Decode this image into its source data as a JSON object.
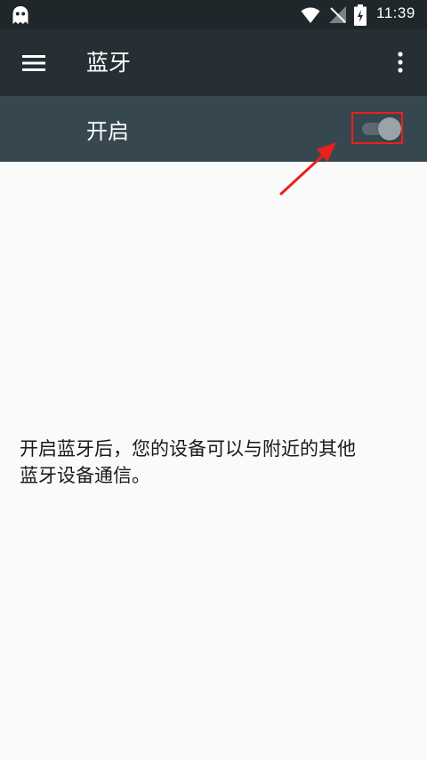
{
  "status_bar": {
    "time": "11:39",
    "icons": [
      "ghost-app-icon",
      "wifi-icon",
      "no-signal-icon",
      "battery-charging-icon"
    ]
  },
  "app_bar": {
    "title": "蓝牙",
    "menu_icon": "menu-icon",
    "overflow_icon": "more-vert-icon"
  },
  "switch_bar": {
    "label": "开启",
    "toggle_state": "off"
  },
  "annotation": {
    "color": "#e8211c"
  },
  "main": {
    "empty_message": "开启蓝牙后，您的设备可以与附近的其他\n蓝牙设备通信。"
  }
}
